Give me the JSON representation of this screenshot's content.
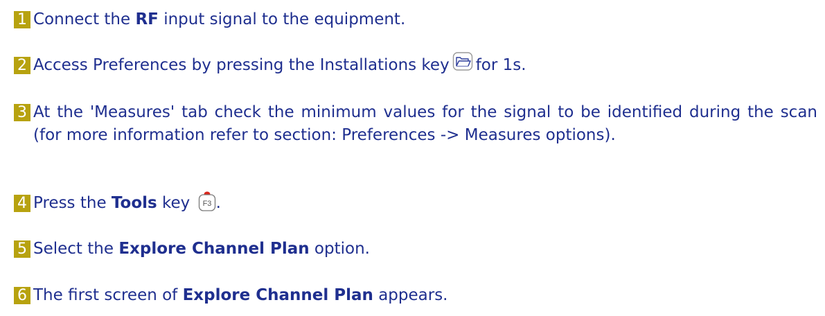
{
  "steps": [
    {
      "number": "1",
      "pre": "Connect the ",
      "bold": "RF",
      "post": " input signal to the equipment."
    },
    {
      "number": "2",
      "pre": "Access Preferences by pressing the Installations key",
      "icon": "folder-open-icon",
      "post": "for 1s."
    },
    {
      "number": "3",
      "text": "At the 'Measures' tab check the minimum values for the signal to be identified during the scan (for more information refer to section: Preferences -> Measures options)."
    },
    {
      "number": "4",
      "pre": "Press the ",
      "bold": "Tools",
      "mid": " key ",
      "icon": "f3-key-icon",
      "key_label": "F3",
      "post": "."
    },
    {
      "number": "5",
      "pre": "Select the ",
      "bold": "Explore Channel Plan",
      "post": " option."
    },
    {
      "number": "6",
      "pre": "The first screen of ",
      "bold": "Explore Channel Plan",
      "post": " appears."
    }
  ],
  "colors": {
    "text": "#1f2f8f",
    "step_badge": "#b7a20f",
    "key_dot": "#d9261c"
  }
}
